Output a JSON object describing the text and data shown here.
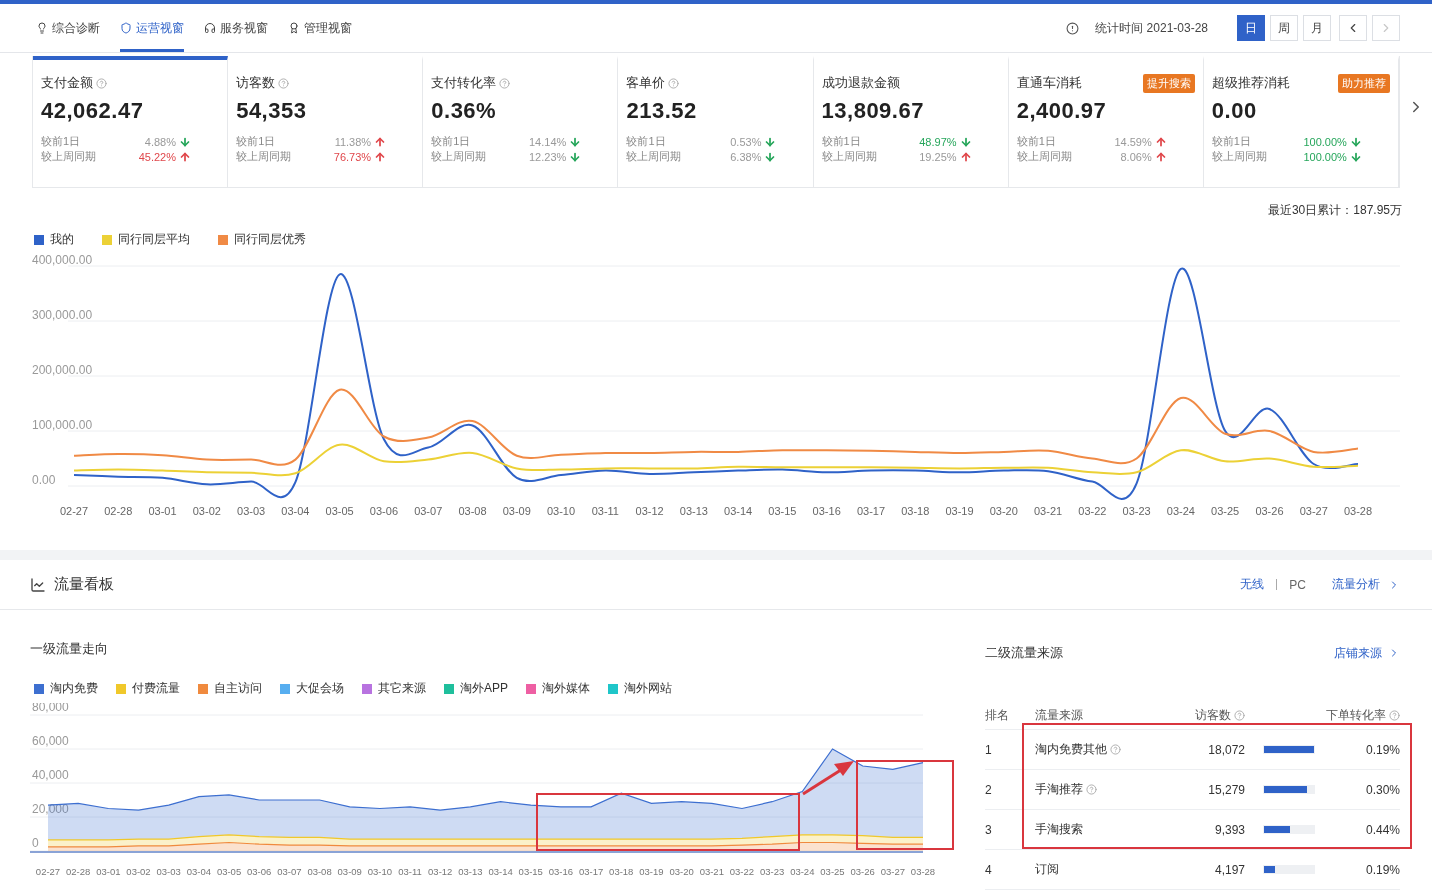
{
  "nav": {
    "tabs": [
      {
        "label": "综合诊断",
        "selected": false
      },
      {
        "label": "运营视窗",
        "selected": true
      },
      {
        "label": "服务视窗",
        "selected": false
      },
      {
        "label": "管理视窗",
        "selected": false
      }
    ],
    "stat_time": "统计时间 2021-03-28",
    "periods": [
      {
        "label": "日",
        "selected": true
      },
      {
        "label": "周",
        "selected": false
      },
      {
        "label": "月",
        "selected": false
      }
    ],
    "next_disabled": true
  },
  "kpis": [
    {
      "title": "支付金额",
      "help": true,
      "value": "42,062.47",
      "selected": true,
      "comparisons": [
        {
          "label": "较前1日",
          "value": "4.88%",
          "rising": false,
          "color": "#999999"
        },
        {
          "label": "较上周同期",
          "value": "45.22%",
          "rising": true,
          "color": "#e0474b"
        }
      ]
    },
    {
      "title": "访客数",
      "help": true,
      "value": "54,353",
      "selected": false,
      "comparisons": [
        {
          "label": "较前1日",
          "value": "11.38%",
          "rising": true,
          "color": "#999999"
        },
        {
          "label": "较上周同期",
          "value": "76.73%",
          "rising": true,
          "color": "#e0474b"
        }
      ]
    },
    {
      "title": "支付转化率",
      "help": true,
      "value": "0.36%",
      "selected": false,
      "comparisons": [
        {
          "label": "较前1日",
          "value": "14.14%",
          "rising": false,
          "color": "#999999"
        },
        {
          "label": "较上周同期",
          "value": "12.23%",
          "rising": false,
          "color": "#999999"
        }
      ]
    },
    {
      "title": "客单价",
      "help": true,
      "value": "213.52",
      "selected": false,
      "comparisons": [
        {
          "label": "较前1日",
          "value": "0.53%",
          "rising": false,
          "color": "#999999"
        },
        {
          "label": "较上周同期",
          "value": "6.38%",
          "rising": false,
          "color": "#999999"
        }
      ]
    },
    {
      "title": "成功退款金额",
      "help": false,
      "value": "13,809.67",
      "selected": false,
      "comparisons": [
        {
          "label": "较前1日",
          "value": "48.97%",
          "rising": false,
          "color": "#26a65b"
        },
        {
          "label": "较上周同期",
          "value": "19.25%",
          "rising": true,
          "color": "#999999"
        }
      ]
    },
    {
      "title": "直通车消耗",
      "help": false,
      "badge": "提升搜索",
      "value": "2,400.97",
      "selected": false,
      "comparisons": [
        {
          "label": "较前1日",
          "value": "14.59%",
          "rising": true,
          "color": "#999999"
        },
        {
          "label": "较上周同期",
          "value": "8.06%",
          "rising": true,
          "color": "#999999"
        }
      ]
    },
    {
      "title": "超级推荐消耗",
      "help": false,
      "badge": "助力推荐",
      "value": "0.00",
      "selected": false,
      "comparisons": [
        {
          "label": "较前1日",
          "value": "100.00%",
          "rising": false,
          "color": "#26a65b"
        },
        {
          "label": "较上周同期",
          "value": "100.00%",
          "rising": false,
          "color": "#26a65b"
        }
      ]
    }
  ],
  "overview": {
    "total": "最近30日累计：187.95万",
    "chart_data": {
      "type": "line",
      "grid": true,
      "categories": [
        "02-27",
        "02-28",
        "03-01",
        "03-02",
        "03-03",
        "03-04",
        "03-05",
        "03-06",
        "03-07",
        "03-08",
        "03-09",
        "03-10",
        "03-11",
        "03-12",
        "03-13",
        "03-14",
        "03-15",
        "03-16",
        "03-17",
        "03-18",
        "03-19",
        "03-20",
        "03-21",
        "03-22",
        "03-23",
        "03-24",
        "03-25",
        "03-26",
        "03-27",
        "03-28"
      ],
      "series": [
        {
          "name": "我的",
          "color": "#2f62c8",
          "values": [
            20000,
            17000,
            15000,
            3000,
            8000,
            7000,
            385000,
            85000,
            70000,
            110000,
            15000,
            20000,
            28000,
            22000,
            25000,
            28000,
            30000,
            25000,
            28000,
            28000,
            25000,
            28000,
            27000,
            8000,
            5000,
            395000,
            100000,
            140000,
            40000,
            40000
          ]
        },
        {
          "name": "同行同层平均",
          "color": "#ecd136",
          "values": [
            28000,
            30000,
            28000,
            25000,
            24000,
            23000,
            75000,
            45000,
            48000,
            60000,
            32000,
            30000,
            32000,
            32000,
            32000,
            35000,
            34000,
            34000,
            34000,
            33000,
            32000,
            33000,
            33000,
            25000,
            25000,
            65000,
            45000,
            50000,
            35000,
            37000
          ]
        },
        {
          "name": "同行同层优秀",
          "color": "#f08a45",
          "values": [
            55000,
            58000,
            56000,
            48000,
            48000,
            48000,
            175000,
            90000,
            88000,
            118000,
            55000,
            57000,
            60000,
            60000,
            62000,
            62000,
            65000,
            65000,
            64000,
            62000,
            60000,
            62000,
            64000,
            50000,
            50000,
            160000,
            95000,
            100000,
            62000,
            68000
          ]
        }
      ],
      "ylim": [
        0,
        400000
      ],
      "yticks": [
        {
          "value": 0,
          "label": "0.00"
        },
        {
          "value": 100000,
          "label": "100,000.00"
        },
        {
          "value": 200000,
          "label": "200,000.00"
        },
        {
          "value": 300000,
          "label": "300,000.00"
        },
        {
          "value": 400000,
          "label": "400,000.00"
        }
      ]
    }
  },
  "traffic": {
    "title": "流量看板",
    "channels": [
      {
        "label": "无线",
        "selected": true
      },
      {
        "label": "PC",
        "selected": false
      }
    ],
    "analysis_link": "流量分析",
    "trend": {
      "title": "一级流量走向",
      "other_legend": [
        {
          "label": "大促会场",
          "color": "#57aef0"
        },
        {
          "label": "其它来源",
          "color": "#b873e0"
        },
        {
          "label": "淘外APP",
          "color": "#1fbf9c"
        },
        {
          "label": "淘外媒体",
          "color": "#ee5fa3"
        },
        {
          "label": "淘外网站",
          "color": "#1fc6c9"
        }
      ],
      "chart_data": {
        "type": "area",
        "stacked": true,
        "grid": true,
        "categories": [
          "02-27",
          "02-28",
          "03-01",
          "03-02",
          "03-03",
          "03-04",
          "03-05",
          "03-06",
          "03-07",
          "03-08",
          "03-09",
          "03-10",
          "03-11",
          "03-12",
          "03-13",
          "03-14",
          "03-15",
          "03-16",
          "03-17",
          "03-18",
          "03-19",
          "03-20",
          "03-21",
          "03-22",
          "03-23",
          "03-24",
          "03-25",
          "03-26",
          "03-27",
          "03-28"
        ],
        "series": [
          {
            "name": "淘内免费",
            "color": "#3d6fd0",
            "values": [
              20500,
              21500,
              18500,
              17000,
              20000,
              23500,
              23500,
              21500,
              22000,
              22000,
              19000,
              18000,
              19000,
              17000,
              19000,
              22000,
              20000,
              19000,
              19000,
              27000,
              21000,
              22000,
              21000,
              17500,
              20500,
              25500,
              50500,
              41000,
              40000,
              44000
            ]
          },
          {
            "name": "付费流量",
            "color": "#f0c82a",
            "values": [
              4000,
              4000,
              4000,
              4000,
              4000,
              4500,
              4500,
              4500,
              4500,
              4500,
              4000,
              4000,
              4000,
              4000,
              4000,
              4000,
              4000,
              4000,
              4000,
              4000,
              4000,
              4000,
              4000,
              4000,
              4500,
              4500,
              4500,
              4500,
              4000,
              4000
            ]
          },
          {
            "name": "自主访问",
            "color": "#f08a3e",
            "values": [
              2500,
              2500,
              2500,
              3000,
              3000,
              4000,
              5000,
              4000,
              3500,
              3500,
              3000,
              3000,
              3000,
              3000,
              3000,
              3000,
              3000,
              3000,
              3000,
              3000,
              3000,
              3000,
              3000,
              3500,
              4000,
              5000,
              5000,
              4500,
              4000,
              4000
            ]
          }
        ],
        "ylim": [
          0,
          80000
        ],
        "yticks": [
          {
            "value": 0,
            "label": "0"
          },
          {
            "value": 20000,
            "label": "20,000"
          },
          {
            "value": 40000,
            "label": "40,000"
          },
          {
            "value": 60000,
            "label": "60,000"
          },
          {
            "value": 80000,
            "label": "80,000"
          }
        ]
      }
    },
    "sources": {
      "title": "二级流量来源",
      "link": "店铺来源",
      "columns": [
        {
          "label": "排名",
          "help": false
        },
        {
          "label": "流量来源",
          "help": false
        },
        {
          "label": "访客数",
          "help": true
        },
        {
          "label": "下单转化率",
          "help": true
        }
      ],
      "rows": [
        {
          "rank": "1",
          "source": "淘内免费其他",
          "help": true,
          "visitors": "18,072",
          "level": 1.0,
          "rate": "0.19%"
        },
        {
          "rank": "2",
          "source": "手淘推荐",
          "help": true,
          "visitors": "15,279",
          "level": 0.85,
          "rate": "0.30%"
        },
        {
          "rank": "3",
          "source": "手淘搜索",
          "help": false,
          "visitors": "9,393",
          "level": 0.52,
          "rate": "0.44%"
        },
        {
          "rank": "4",
          "source": "订阅",
          "help": false,
          "visitors": "4,197",
          "level": 0.22,
          "rate": "0.19%"
        }
      ]
    }
  }
}
